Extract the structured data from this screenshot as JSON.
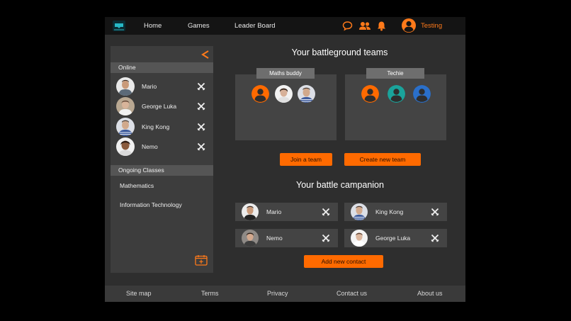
{
  "nav": {
    "home": "Home",
    "games": "Games",
    "leaderboard": "Leader Board"
  },
  "user": {
    "name": "Testing"
  },
  "sidebar": {
    "online_label": "Online",
    "online": [
      {
        "name": "Mario"
      },
      {
        "name": "George Luka"
      },
      {
        "name": "King Kong"
      },
      {
        "name": "Nemo"
      }
    ],
    "classes_label": "Ongoing Classes",
    "classes": [
      "Mathematics",
      "Information Technology"
    ]
  },
  "teams": {
    "title": "Your battleground teams",
    "list": [
      {
        "name": "Maths buddy"
      },
      {
        "name": "Techie"
      }
    ],
    "join_label": "Join a team",
    "create_label": "Create new team"
  },
  "companions": {
    "title": "Your battle campanion",
    "list": [
      {
        "name": "Mario"
      },
      {
        "name": "King Kong"
      },
      {
        "name": "Nemo"
      },
      {
        "name": "George Luka"
      }
    ],
    "add_label": "Add new contact"
  },
  "footer": [
    "Site map",
    "Terms",
    "Privacy",
    "Contact us",
    "About us"
  ],
  "colors": {
    "accent": "#ff6a00",
    "teal": "#1aa39b",
    "blue": "#2a6fc9"
  }
}
